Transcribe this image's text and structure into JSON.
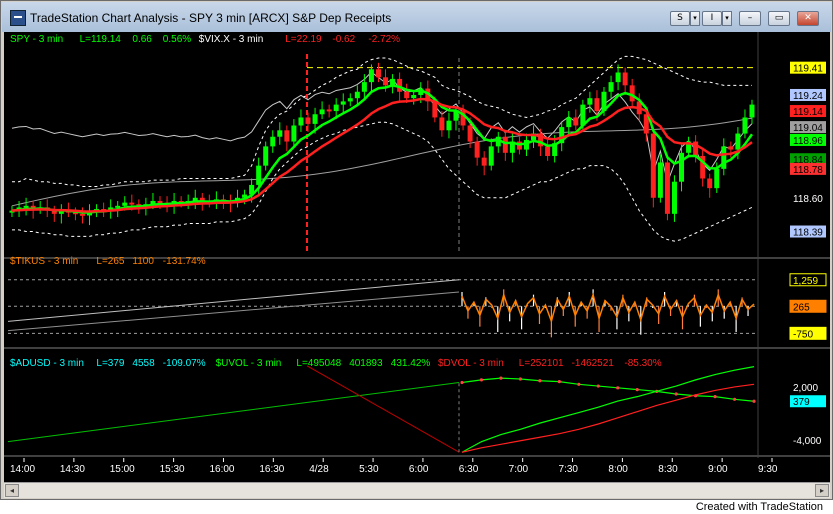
{
  "window": {
    "title": "TradeStation Chart Analysis - SPY 3 min [ARCX] S&P Dep Receipts",
    "toolbar_s": "S",
    "toolbar_i": "I",
    "minimize": "–",
    "restore": "▭",
    "close": "✕"
  },
  "credit": "Created with TradeStation",
  "colors": {
    "background": "#000000",
    "up": "#00ff00",
    "down": "#ff0000",
    "gridline": "#555555",
    "axis_text": "#ffffff"
  },
  "chart_data": [
    {
      "type": "candlestick",
      "panel": "price",
      "legend": [
        {
          "text": "SPY - 3 min",
          "color": "#00ff00"
        },
        {
          "text": "L=119.14",
          "color": "#00ff00"
        },
        {
          "text": "0.66",
          "color": "#00ff00"
        },
        {
          "text": "0.56%",
          "color": "#00ff00"
        },
        {
          "text": "$VIX.X - 3 min",
          "color": "#ffffff"
        },
        {
          "text": "L=22.19",
          "color": "#ff2020"
        },
        {
          "text": "-0.62",
          "color": "#ff2020"
        },
        {
          "text": "-2.72%",
          "color": "#ff2020"
        }
      ],
      "ylim": [
        118.25,
        119.52
      ],
      "y_tick_labels": [
        "118.60"
      ],
      "price_tags": [
        {
          "label": "119.41",
          "bg": "#ffff00",
          "fg": "#000000",
          "value": 119.41
        },
        {
          "label": "119.24",
          "bg": "#b0c8ff",
          "fg": "#000000",
          "value": 119.24
        },
        {
          "label": "119.14",
          "bg": "#ff2020",
          "fg": "#000000",
          "value": 119.14
        },
        {
          "label": "119.04",
          "bg": "#a0a0a0",
          "fg": "#000000",
          "value": 119.04
        },
        {
          "label": "118.96",
          "bg": "#00ff00",
          "fg": "#000000",
          "value": 118.96
        },
        {
          "label": "118.84",
          "bg": "#00a000",
          "fg": "#000000",
          "value": 118.84
        },
        {
          "label": "118.78",
          "bg": "#ff3030",
          "fg": "#000000",
          "value": 118.78
        },
        {
          "label": "118.39",
          "bg": "#b0c8ff",
          "fg": "#000000",
          "value": 118.39
        }
      ],
      "reference_line": 119.41,
      "close_series": [
        118.52,
        118.54,
        118.55,
        118.53,
        118.54,
        118.52,
        118.5,
        118.52,
        118.51,
        118.5,
        118.49,
        118.51,
        118.53,
        118.52,
        118.54,
        118.55,
        118.57,
        118.56,
        118.55,
        118.56,
        118.58,
        118.57,
        118.56,
        118.58,
        118.57,
        118.58,
        118.6,
        118.58,
        118.57,
        118.59,
        118.58,
        118.57,
        118.6,
        118.62,
        118.68,
        118.8,
        118.92,
        118.98,
        119.02,
        118.95,
        119.05,
        119.1,
        119.06,
        119.12,
        119.15,
        119.14,
        119.18,
        119.2,
        119.22,
        119.26,
        119.32,
        119.4,
        119.35,
        119.3,
        119.34,
        119.26,
        119.22,
        119.24,
        119.28,
        119.2,
        119.1,
        119.02,
        119.08,
        119.14,
        119.05,
        118.95,
        118.85,
        118.8,
        118.92,
        118.98,
        118.88,
        118.95,
        118.9,
        118.96,
        119.0,
        118.92,
        118.86,
        118.94,
        119.04,
        119.1,
        119.05,
        119.18,
        119.22,
        119.14,
        119.26,
        119.32,
        119.38,
        119.3,
        119.2,
        119.12,
        119.0,
        118.6,
        118.82,
        118.5,
        118.7,
        118.88,
        118.95,
        118.86,
        118.72,
        118.66,
        118.78,
        118.92,
        118.9,
        119.0,
        119.1,
        119.18
      ],
      "upper_band": [
        118.7,
        118.7,
        118.72,
        118.71,
        118.7,
        118.7,
        118.69,
        118.69,
        118.68,
        118.68,
        118.67,
        118.67,
        118.67,
        118.68,
        118.68,
        118.69,
        118.7,
        118.7,
        118.7,
        118.7,
        118.71,
        118.71,
        118.71,
        118.71,
        118.72,
        118.72,
        118.72,
        118.72,
        118.72,
        118.72,
        118.72,
        118.72,
        118.73,
        118.74,
        118.8,
        118.92,
        119.02,
        119.08,
        119.12,
        119.14,
        119.18,
        119.22,
        119.24,
        119.27,
        119.3,
        119.32,
        119.35,
        119.37,
        119.39,
        119.4,
        119.44,
        119.46,
        119.47,
        119.47,
        119.46,
        119.44,
        119.42,
        119.4,
        119.39,
        119.37,
        119.35,
        119.3,
        119.28,
        119.27,
        119.25,
        119.23,
        119.2,
        119.18,
        119.17,
        119.16,
        119.14,
        119.12,
        119.11,
        119.1,
        119.11,
        119.12,
        119.14,
        119.15,
        119.18,
        119.2,
        119.22,
        119.26,
        119.3,
        119.34,
        119.38,
        119.42,
        119.46,
        119.48,
        119.48,
        119.47,
        119.46,
        119.44,
        119.42,
        119.4,
        119.38,
        119.36,
        119.34,
        119.33,
        119.32,
        119.32,
        119.31,
        119.3,
        119.3,
        119.3,
        119.3,
        119.3
      ],
      "lower_band": [
        118.4,
        118.4,
        118.39,
        118.39,
        118.38,
        118.38,
        118.37,
        118.37,
        118.36,
        118.36,
        118.36,
        118.36,
        118.37,
        118.37,
        118.38,
        118.38,
        118.39,
        118.4,
        118.4,
        118.41,
        118.42,
        118.42,
        118.42,
        118.43,
        118.43,
        118.44,
        118.44,
        118.44,
        118.44,
        118.45,
        118.45,
        118.45,
        118.46,
        118.47,
        118.5,
        118.56,
        118.64,
        118.72,
        118.78,
        118.82,
        118.86,
        118.9,
        118.92,
        118.95,
        118.97,
        118.99,
        119.0,
        119.02,
        119.03,
        119.04,
        119.05,
        119.06,
        119.07,
        119.07,
        119.06,
        119.04,
        119.02,
        119.0,
        118.98,
        118.95,
        118.9,
        118.84,
        118.78,
        118.74,
        118.7,
        118.66,
        118.62,
        118.6,
        118.6,
        118.6,
        118.6,
        118.62,
        118.64,
        118.66,
        118.68,
        118.7,
        118.7,
        118.72,
        118.74,
        118.76,
        118.78,
        118.78,
        118.8,
        118.8,
        118.8,
        118.78,
        118.74,
        118.68,
        118.6,
        118.52,
        118.46,
        118.4,
        118.36,
        118.34,
        118.33,
        118.34,
        118.36,
        118.38,
        118.4,
        118.42,
        118.44,
        118.46,
        118.48,
        118.5,
        118.52,
        118.54
      ]
    },
    {
      "type": "line",
      "panel": "tikus",
      "legend": [
        {
          "text": "$TIKUS - 3 min",
          "color": "#ff8000"
        },
        {
          "text": "L=265",
          "color": "#ff8000"
        },
        {
          "text": "1100",
          "color": "#ff8000"
        },
        {
          "text": "-131.74%",
          "color": "#ff8000"
        }
      ],
      "ylim": [
        -1150,
        1550
      ],
      "tags": [
        {
          "label": "1,259",
          "bg": "#000000",
          "fg": "#ffff00",
          "border": "#ffff00",
          "value": 1259
        },
        {
          "label": "265",
          "bg": "#ff8000",
          "fg": "#000000",
          "border": "#ff8000",
          "value": 265
        },
        {
          "label": "-750",
          "bg": "#ffff00",
          "fg": "#000000",
          "border": "#ffff00",
          "value": -750
        }
      ],
      "reference_lines": [
        1259,
        265,
        -750
      ],
      "values": [
        800,
        -200,
        400,
        -500,
        600,
        200,
        -700,
        900,
        -300,
        500,
        -600,
        300,
        700,
        -400,
        200,
        -900,
        600,
        -100,
        800,
        -500,
        400,
        -200,
        900,
        -700,
        500,
        100,
        -600,
        700,
        -300,
        400,
        -800,
        600,
        200,
        -400,
        800,
        -100,
        500,
        -600,
        300,
        700,
        -500,
        200,
        -300,
        900,
        -200,
        400,
        -700,
        600,
        -100,
        265
      ]
    },
    {
      "type": "line",
      "panel": "breadth",
      "legend": [
        {
          "text": "$ADUSD - 3 min",
          "color": "#00ffff"
        },
        {
          "text": "L=379",
          "color": "#00ffff"
        },
        {
          "text": "4558",
          "color": "#00ffff"
        },
        {
          "text": "-109.07%",
          "color": "#00ffff"
        },
        {
          "text": "$UVOL - 3 min",
          "color": "#00ff00"
        },
        {
          "text": "L=495048",
          "color": "#00ff00"
        },
        {
          "text": "401893",
          "color": "#00ff00"
        },
        {
          "text": "431.42%",
          "color": "#00ff00"
        },
        {
          "text": "$DVOL - 3 min",
          "color": "#ff2020"
        },
        {
          "text": "L=252101",
          "color": "#ff2020"
        },
        {
          "text": "-1462521",
          "color": "#ff2020"
        },
        {
          "text": "-85.30%",
          "color": "#ff2020"
        }
      ],
      "ylim": [
        -5600,
        4600
      ],
      "y_tick_labels": [
        "2,000",
        "-4,000"
      ],
      "y_ticks": [
        2000,
        -4000
      ],
      "tags": [
        {
          "label": "379",
          "bg": "#00ffff",
          "fg": "#000000",
          "value": 379
        }
      ],
      "series": [
        {
          "name": "$ADUSD",
          "color": "#00ff00",
          "values": [
            2500,
            2800,
            3000,
            2900,
            2700,
            2600,
            2300,
            2100,
            1900,
            1700,
            1500,
            1200,
            1000,
            900,
            600,
            379
          ]
        },
        {
          "name": "$UVOL",
          "color": "#00ff00",
          "values": [
            -5400,
            -4200,
            -3400,
            -2800,
            -2100,
            -1500,
            -900,
            -300,
            400,
            900,
            1500,
            2100,
            2800,
            3400,
            3900,
            4300
          ]
        },
        {
          "name": "$DVOL",
          "color": "#ff2020",
          "values": [
            -5400,
            -4900,
            -4500,
            -4100,
            -3700,
            -3300,
            -2800,
            -2200,
            -1500,
            -800,
            -100,
            500,
            1100,
            1600,
            2000,
            2300
          ]
        }
      ]
    },
    {
      "type": "axis",
      "panel": "time",
      "x_tick_labels": [
        "14:00",
        "14:30",
        "15:00",
        "15:30",
        "16:00",
        "16:30",
        "4/28",
        "5:30",
        "6:00",
        "6:30",
        "7:00",
        "7:30",
        "8:00",
        "8:30",
        "9:00",
        "9:30"
      ]
    }
  ]
}
